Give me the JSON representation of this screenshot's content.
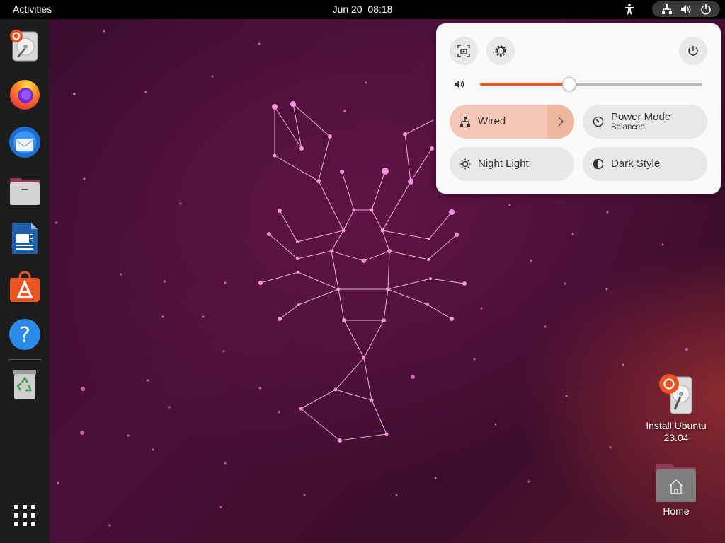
{
  "topbar": {
    "activities": "Activities",
    "date": "Jun 20",
    "time": "08:18",
    "icons": [
      "accessibility-icon",
      "network-wired-icon",
      "volume-icon",
      "power-icon"
    ]
  },
  "dock": {
    "items": [
      {
        "name": "install-ubuntu",
        "icon": "installer-icon"
      },
      {
        "name": "firefox",
        "icon": "firefox-icon"
      },
      {
        "name": "thunderbird",
        "icon": "thunderbird-icon"
      },
      {
        "name": "files",
        "icon": "files-icon"
      },
      {
        "name": "libreoffice-writer",
        "icon": "writer-icon"
      },
      {
        "name": "ubuntu-software",
        "icon": "software-icon"
      },
      {
        "name": "help",
        "icon": "help-icon"
      },
      {
        "name": "trash",
        "icon": "trash-icon"
      }
    ],
    "show_apps_icon": "app-grid-icon"
  },
  "quick_settings": {
    "buttons": [
      "screenshot-icon",
      "settings-icon",
      "power-icon"
    ],
    "volume": {
      "level": 0.4,
      "icon": "speaker-icon"
    },
    "toggles": {
      "wired": {
        "label": "Wired",
        "active": true,
        "icon": "network-wired-icon"
      },
      "power_mode": {
        "label": "Power Mode",
        "sub": "Balanced",
        "icon": "power-mode-icon"
      },
      "night_light": {
        "label": "Night Light",
        "icon": "night-light-icon"
      },
      "dark_style": {
        "label": "Dark Style",
        "icon": "dark-style-icon"
      }
    }
  },
  "desktop": {
    "install_ubuntu": {
      "label_line1": "Install Ubuntu",
      "label_line2": "23.04"
    },
    "home": {
      "label": "Home"
    }
  },
  "colors": {
    "accent": "#e95420",
    "active_toggle": "#f4c6b6",
    "panel": "#fafafa",
    "topbar": "#000000",
    "dock": "#1d1d1d"
  }
}
